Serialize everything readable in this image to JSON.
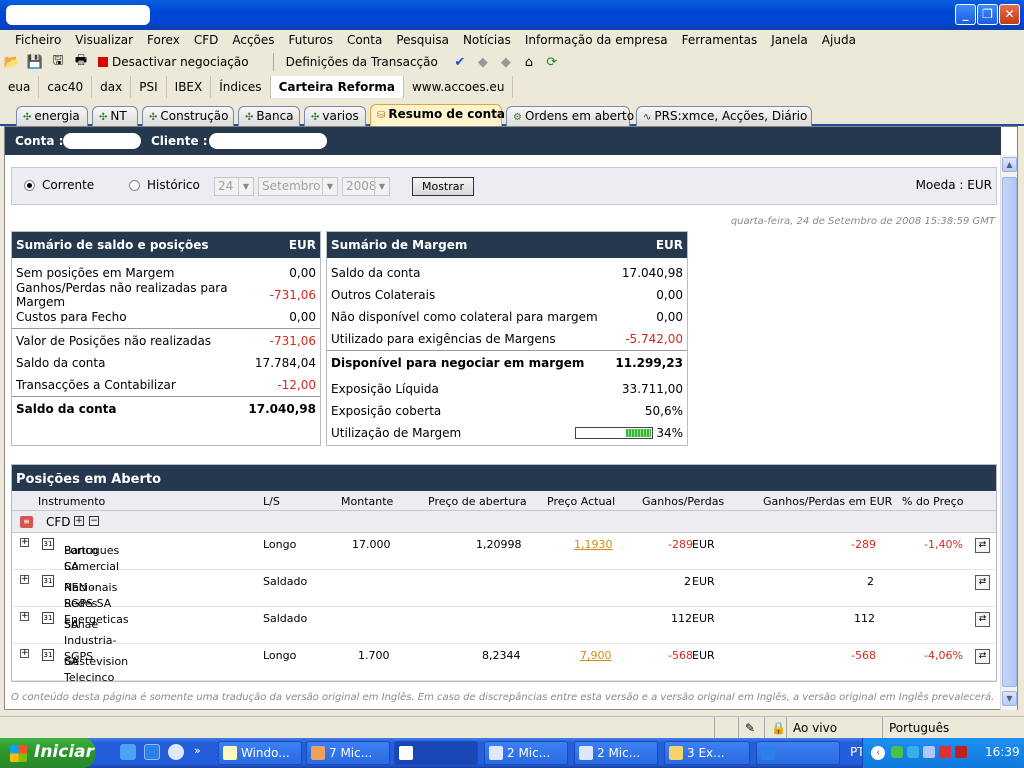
{
  "window": {
    "controls": [
      "_",
      "❐",
      "✕"
    ]
  },
  "menu": [
    "Ficheiro",
    "Visualizar",
    "Forex",
    "CFD",
    "Acções",
    "Futuros",
    "Conta",
    "Pesquisa",
    "Notícias",
    "Informação da empresa",
    "Ferramentas",
    "Janela",
    "Ajuda"
  ],
  "toolbar": {
    "disable_trading": "Desactivar negociação",
    "transaction_settings": "Definições da Transacção"
  },
  "quick_tabs": [
    "eua",
    "cac40",
    "dax",
    "PSI",
    "IBEX",
    "Índices",
    "Carteira Reforma",
    "www.accoes.eu"
  ],
  "tabs": [
    "energia",
    "NT",
    "Construção",
    "Banca",
    "varios",
    "Resumo de conta",
    "Ordens em aberto",
    "PRS:xmce, Acções, Diário"
  ],
  "account": {
    "conta_label": "Conta :",
    "cliente_label": "Cliente :"
  },
  "filter": {
    "corrente": "Corrente",
    "historico": "Histórico",
    "day": "24",
    "month": "Setembro",
    "year": "2008",
    "show_button": "Mostrar",
    "currency": "Moeda : EUR"
  },
  "datestamp": "quarta-feira, 24 de Setembro de 2008 15:38:59 GMT",
  "balance": {
    "title": "Sumário de saldo e posições",
    "currency": "EUR",
    "rows": [
      {
        "label": "Sem posições em Margem",
        "value": "0,00"
      },
      {
        "label": "Ganhos/Perdas não realizadas para Margem",
        "value": "-731,06"
      },
      {
        "label": "Custos para Fecho",
        "value": "0,00"
      },
      {
        "label": "Valor de Posições não realizadas",
        "value": "-731,06"
      },
      {
        "label": "Saldo da conta",
        "value": "17.784,04"
      },
      {
        "label": "Transacções a Contabilizar",
        "value": "-12,00"
      },
      {
        "label": "Saldo da conta",
        "value": "17.040,98"
      }
    ]
  },
  "margin": {
    "title": "Sumário de Margem",
    "currency": "EUR",
    "rows": [
      {
        "label": "Saldo da conta",
        "value": "17.040,98"
      },
      {
        "label": "Outros Colaterais",
        "value": "0,00"
      },
      {
        "label": "Não disponível como colateral para margem",
        "value": "0,00"
      },
      {
        "label": "Utilizado para exigências de Margens",
        "value": "-5.742,00"
      },
      {
        "label": "Disponível para negociar em margem",
        "value": "11.299,23"
      },
      {
        "label": "Exposição Líquida",
        "value": "33.711,00"
      },
      {
        "label": "Exposição coberta",
        "value": "50,6%"
      },
      {
        "label": "Utilização de Margem",
        "value": "34%"
      }
    ],
    "utilization_fraction": 0.34
  },
  "positions": {
    "title": "Posições em Aberto",
    "columns": [
      "Instrumento",
      "L/S",
      "Montante",
      "Preço de abertura",
      "Preço Actual",
      "Ganhos/Perdas",
      "Ganhos/Perdas em EUR",
      "% do Preço"
    ],
    "group": "CFD",
    "rows": [
      {
        "name1": "Banco Comercial",
        "name2": "Portugues SA",
        "ls": "Longo",
        "amount": "17.000",
        "open": "1,20998",
        "current": "1,1930",
        "pl": "-289",
        "pl_cur": "EUR",
        "pl_eur": "-289",
        "pct": "-1,40%"
      },
      {
        "name1": "REN - Redes Energeticas",
        "name2": "Nacionais SGPS SA",
        "ls": "Saldado",
        "amount": "",
        "open": "",
        "current": "",
        "pl": "2",
        "pl_cur": "EUR",
        "pl_eur": "2",
        "pct": ""
      },
      {
        "name1": "Sonae Industria-SGPS",
        "name2": "SA",
        "ls": "Saldado",
        "amount": "",
        "open": "",
        "current": "",
        "pl": "112",
        "pl_cur": "EUR",
        "pl_eur": "112",
        "pct": ""
      },
      {
        "name1": "Gestevision Telecinco",
        "name2": "SA",
        "ls": "Longo",
        "amount": "1.700",
        "open": "8,2344",
        "current": "7,900",
        "pl": "-568",
        "pl_cur": "EUR",
        "pl_eur": "-568",
        "pct": "-4,06%"
      }
    ]
  },
  "footer_note": "O conteúdo desta página é somente uma tradução da versão original em Inglês. Em caso de discrepâncias entre esta versão e a versão original em Inglês, a versão original em Inglês prevalecerá.",
  "status": {
    "live": "Ao vivo",
    "language": "Português"
  },
  "taskbar": {
    "start": "Iniciar",
    "tasks": [
      "Windo...",
      "7 Mic...",
      "",
      "2 Mic...",
      "2 Mic...",
      "3 Ex...",
      ""
    ],
    "tray_lang": "PT",
    "clock": "16:39"
  },
  "colors": {
    "header_navy": "#26384e",
    "negative": "#d62a1e",
    "link_orange": "#d48a1a",
    "xp_blue": "#245edb"
  }
}
